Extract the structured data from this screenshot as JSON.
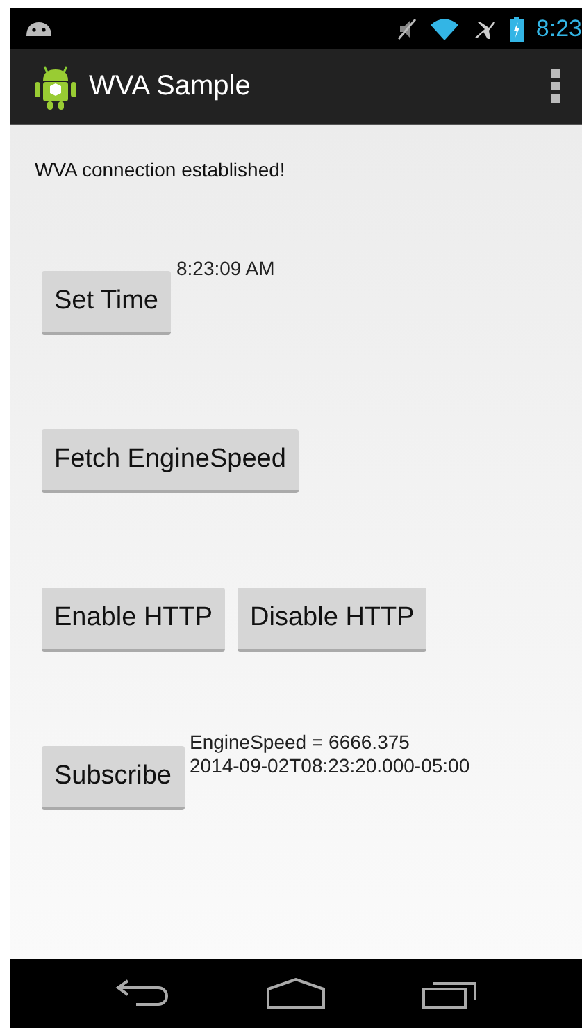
{
  "status_bar": {
    "time": "8:23"
  },
  "action_bar": {
    "title": "WVA Sample"
  },
  "message": "WVA connection established!",
  "rows": [
    {
      "buttons": [
        "Set Time"
      ],
      "outputs": [
        "8:23:09 AM"
      ]
    },
    {
      "buttons": [
        "Fetch EngineSpeed"
      ],
      "outputs": []
    },
    {
      "buttons": [
        "Enable HTTP",
        "Disable HTTP"
      ],
      "outputs": []
    },
    {
      "buttons": [
        "Subscribe"
      ],
      "outputs": [
        "EngineSpeed = 6666.375",
        "2014-09-02T08:23:20.000-05:00"
      ]
    }
  ]
}
